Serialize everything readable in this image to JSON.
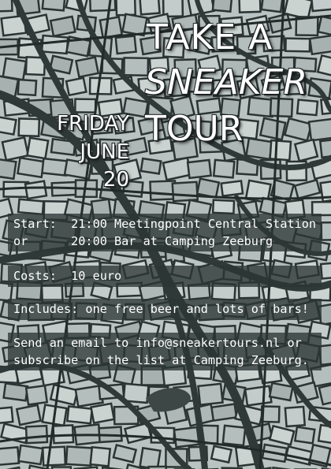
{
  "title": [
    "TAKE A",
    "SNEAKER",
    "TOUR"
  ],
  "date": [
    "FRIDAY",
    "JUNE",
    "20"
  ],
  "info": {
    "start_line": "Start:  21:00 Meetingpoint Central Station",
    "or_line": "or      20:00 Bar at Camping Zeeburg",
    "costs_line": "Costs:  10 euro",
    "includes_line": "Includes: one free beer and lots of bars!",
    "email_line_1": "Send an email to info@sneakertours.nl or",
    "email_line_2": "subscribe on the list at Camping Zeeburg."
  },
  "colors": {
    "block": "#b9c3c1",
    "street": "#2b3433",
    "water": "#3c4746",
    "text": "#ffffff"
  }
}
